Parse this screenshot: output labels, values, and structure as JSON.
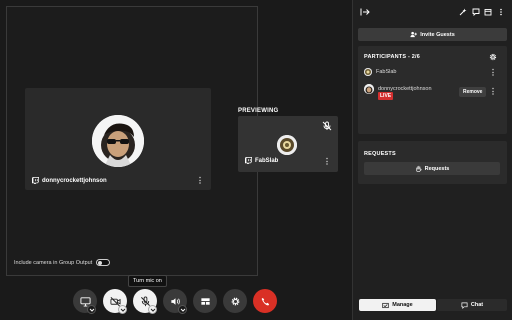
{
  "stage": {
    "main_participant": "donnycrockettjohnson",
    "include_camera_label": "Include camera in Group Output",
    "include_camera_on": false
  },
  "preview": {
    "label": "PREVIEWING",
    "participant": "FabSlab"
  },
  "controls": {
    "tooltip": "Turn mic on"
  },
  "panel": {
    "invite_label": "Invite Guests",
    "participants_title": "PARTICIPANTS - 2/6",
    "participants": [
      {
        "name": "FabSlab"
      },
      {
        "name": "donnycrockettjohnson",
        "badge": "LIVE",
        "action": "Remove"
      }
    ],
    "requests_title": "REQUESTS",
    "requests_button": "Requests",
    "tabs": [
      {
        "label": "Manage",
        "active": true
      },
      {
        "label": "Chat",
        "active": false
      }
    ]
  },
  "colors": {
    "live": "#d32f2f",
    "end_call": "#d93025",
    "background": "#1a1a1a"
  }
}
